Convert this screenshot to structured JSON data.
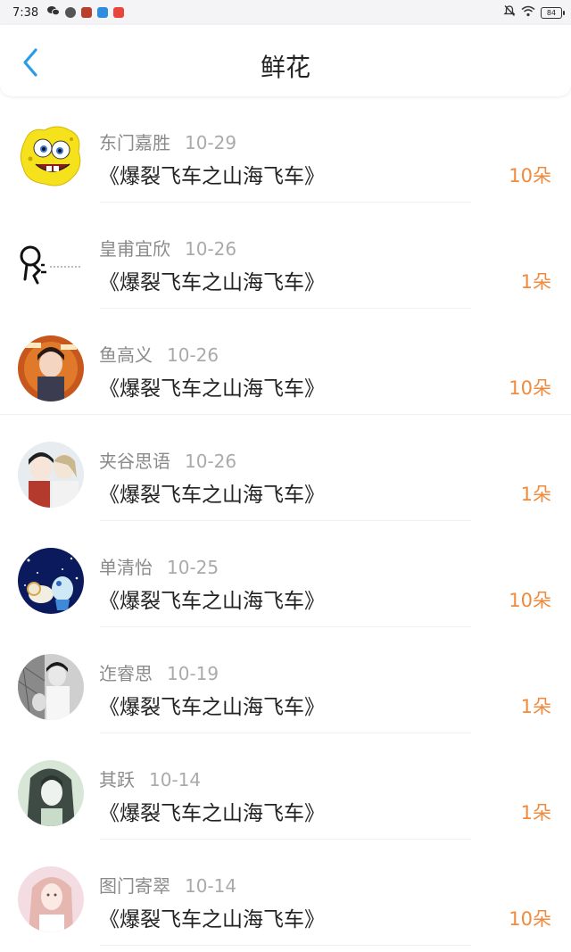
{
  "status_bar": {
    "time": "7:38",
    "battery": "84"
  },
  "header": {
    "title": "鲜花"
  },
  "colors": {
    "accent_blue": "#2b9be8",
    "count_orange": "#f08a3c"
  },
  "items": [
    {
      "user": "东门嘉胜",
      "date": "10-29",
      "title": "《爆裂飞车之山海飞车》",
      "count": "10朵"
    },
    {
      "user": "皇甫宜欣",
      "date": "10-26",
      "title": "《爆裂飞车之山海飞车》",
      "count": "1朵"
    },
    {
      "user": "鱼高义",
      "date": "10-26",
      "title": "《爆裂飞车之山海飞车》",
      "count": "10朵"
    },
    {
      "user": "夹谷思语",
      "date": "10-26",
      "title": "《爆裂飞车之山海飞车》",
      "count": "1朵"
    },
    {
      "user": "单清怡",
      "date": "10-25",
      "title": "《爆裂飞车之山海飞车》",
      "count": "10朵"
    },
    {
      "user": "迮睿思",
      "date": "10-19",
      "title": "《爆裂飞车之山海飞车》",
      "count": "1朵"
    },
    {
      "user": "其跃",
      "date": "10-14",
      "title": "《爆裂飞车之山海飞车》",
      "count": "1朵"
    },
    {
      "user": "图门寄翠",
      "date": "10-14",
      "title": "《爆裂飞车之山海飞车》",
      "count": "10朵"
    }
  ]
}
